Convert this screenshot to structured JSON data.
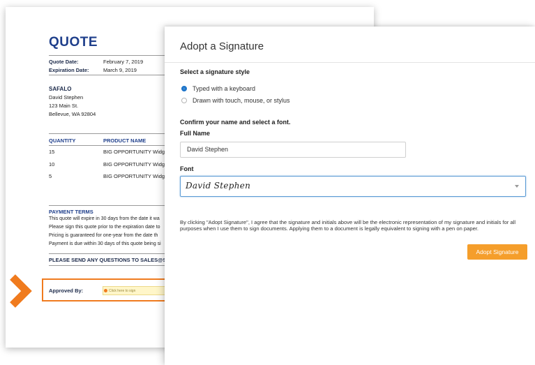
{
  "quote": {
    "title": "QUOTE",
    "quote_date_label": "Quote Date:",
    "quote_date": "February 7, 2019",
    "expiration_date_label": "Expiration Date:",
    "expiration_date": "March 9, 2019",
    "company": "SAFALO",
    "address": [
      "David Stephen",
      "123 Main St.",
      "Bellevue, WA 92804"
    ],
    "columns": [
      "QUANTITY",
      "PRODUCT NAME"
    ],
    "rows": [
      {
        "quantity": "15",
        "product": "BIG OPPORTUNITY Widg"
      },
      {
        "quantity": "10",
        "product": "BIG OPPORTUNITY Widg"
      },
      {
        "quantity": "5",
        "product": "BIG OPPORTUNITY Widg"
      }
    ],
    "payment_terms_heading": "PAYMENT TERMS",
    "payment_terms": [
      "This quote will expire in 30 days from the date it wa",
      "Please sign this quote prior to the expiration date to",
      "Pricing is guaranteed for one-year from the date th",
      "Payment is due within 30 days of this quote being si"
    ],
    "questions_line": "PLEASE SEND ANY QUESTIONS TO SALES@SAF",
    "approved_by_label": "Approved By:",
    "sign_here_label": "Click here to sign"
  },
  "modal": {
    "title": "Adopt a Signature",
    "style_heading": "Select a signature style",
    "style_options": [
      {
        "label": "Typed with a keyboard",
        "selected": true
      },
      {
        "label": "Drawn with touch, mouse, or stylus",
        "selected": false
      }
    ],
    "confirm_heading": "Confirm your name and select a font.",
    "full_name_label": "Full Name",
    "full_name_value": "David Stephen",
    "font_label": "Font",
    "font_preview": "David Stephen",
    "legal_text": "By clicking \"Adopt Signature\", I agree that the signature and initials above will be the electronic representation of my signature and initials for all purposes when I use them to sign documents. Applying them to a document is legally equivalent to signing with a pen on paper.",
    "adopt_button": "Adopt Signature"
  },
  "colors": {
    "accent_orange": "#f07b1e",
    "button_orange": "#f59e2b",
    "quote_blue": "#1f3f8b",
    "radio_blue": "#1a73c9"
  },
  "icons": [
    "chevron-right-icon",
    "radio-selected-icon",
    "radio-unselected-icon",
    "dropdown-caret-icon",
    "sign-flag-icon"
  ]
}
